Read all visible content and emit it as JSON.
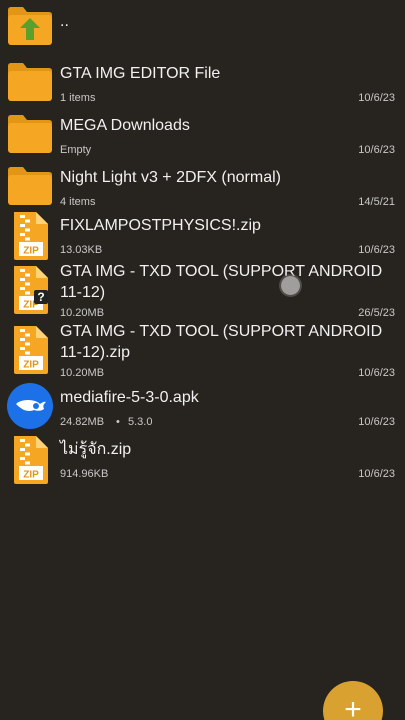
{
  "files": [
    {
      "type": "folder-up",
      "icon": "parent-folder-icon",
      "name": ".."
    },
    {
      "type": "folder",
      "icon": "folder-icon",
      "name": "GTA IMG EDITOR File",
      "meta": "1 items",
      "date": "10/6/23"
    },
    {
      "type": "folder",
      "icon": "folder-icon",
      "name": "MEGA Downloads",
      "meta": "Empty",
      "date": "10/6/23"
    },
    {
      "type": "folder",
      "icon": "folder-icon",
      "name": "Night Light v3 + 2DFX (normal)",
      "meta": "4 items",
      "date": "14/5/21"
    },
    {
      "type": "zip",
      "icon": "zip-file-icon",
      "name": "FIXLAMPOSTPHYSICS!.zip",
      "meta": "13.03KB",
      "date": "10/6/23",
      "badge": "ZIP"
    },
    {
      "type": "zip-unknown",
      "icon": "unknown-zip-file-icon",
      "name": "GTA IMG - TXD TOOL (SUPPORT ANDROID 11-12)",
      "meta": "10.20MB",
      "date": "26/5/23",
      "badge": "ZIP",
      "overlay": "?"
    },
    {
      "type": "zip",
      "icon": "zip-file-icon",
      "name": "GTA IMG - TXD TOOL (SUPPORT ANDROID 11-12).zip",
      "meta": "10.20MB",
      "date": "10/6/23",
      "badge": "ZIP"
    },
    {
      "type": "apk",
      "icon": "mediafire-app-icon",
      "name": "mediafire-5-3-0.apk",
      "meta": "24.82MB",
      "sep": "•",
      "version": "5.3.0",
      "date": "10/6/23"
    },
    {
      "type": "zip",
      "icon": "zip-file-icon",
      "name": "ไม่รู้จัก.zip",
      "meta": "914.96KB",
      "date": "10/6/23",
      "badge": "ZIP"
    }
  ],
  "fab": {
    "label": "+",
    "icon": "add-icon"
  },
  "colors": {
    "background": "#27231e",
    "folder": "#f5a623",
    "folder_tab": "#e39514",
    "accent": "#d9a230",
    "mediafire": "#1d71e8",
    "arrow": "#5aa02c"
  }
}
